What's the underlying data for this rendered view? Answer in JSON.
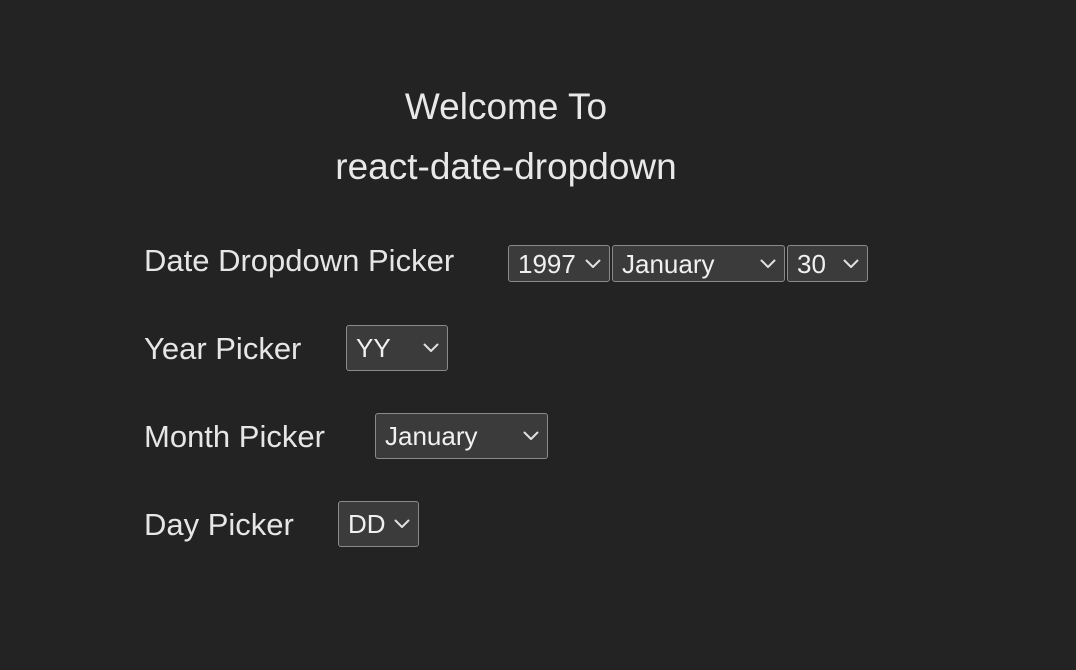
{
  "header": {
    "line1": "Welcome To",
    "line2": "react-date-dropdown"
  },
  "rows": {
    "date_dropdown": {
      "label": "Date Dropdown Picker",
      "year_value": "1997",
      "month_value": "January",
      "day_value": "30"
    },
    "year_picker": {
      "label": "Year Picker",
      "value": "YY"
    },
    "month_picker": {
      "label": "Month Picker",
      "value": "January"
    },
    "day_picker": {
      "label": "Day Picker",
      "value": "DD"
    }
  },
  "colors": {
    "background": "#232323",
    "select_background": "#3b3b3b",
    "select_border": "#8a8a8a",
    "text": "#e6e6e6"
  },
  "icons": {
    "dropdown": "chevron-down-icon"
  }
}
